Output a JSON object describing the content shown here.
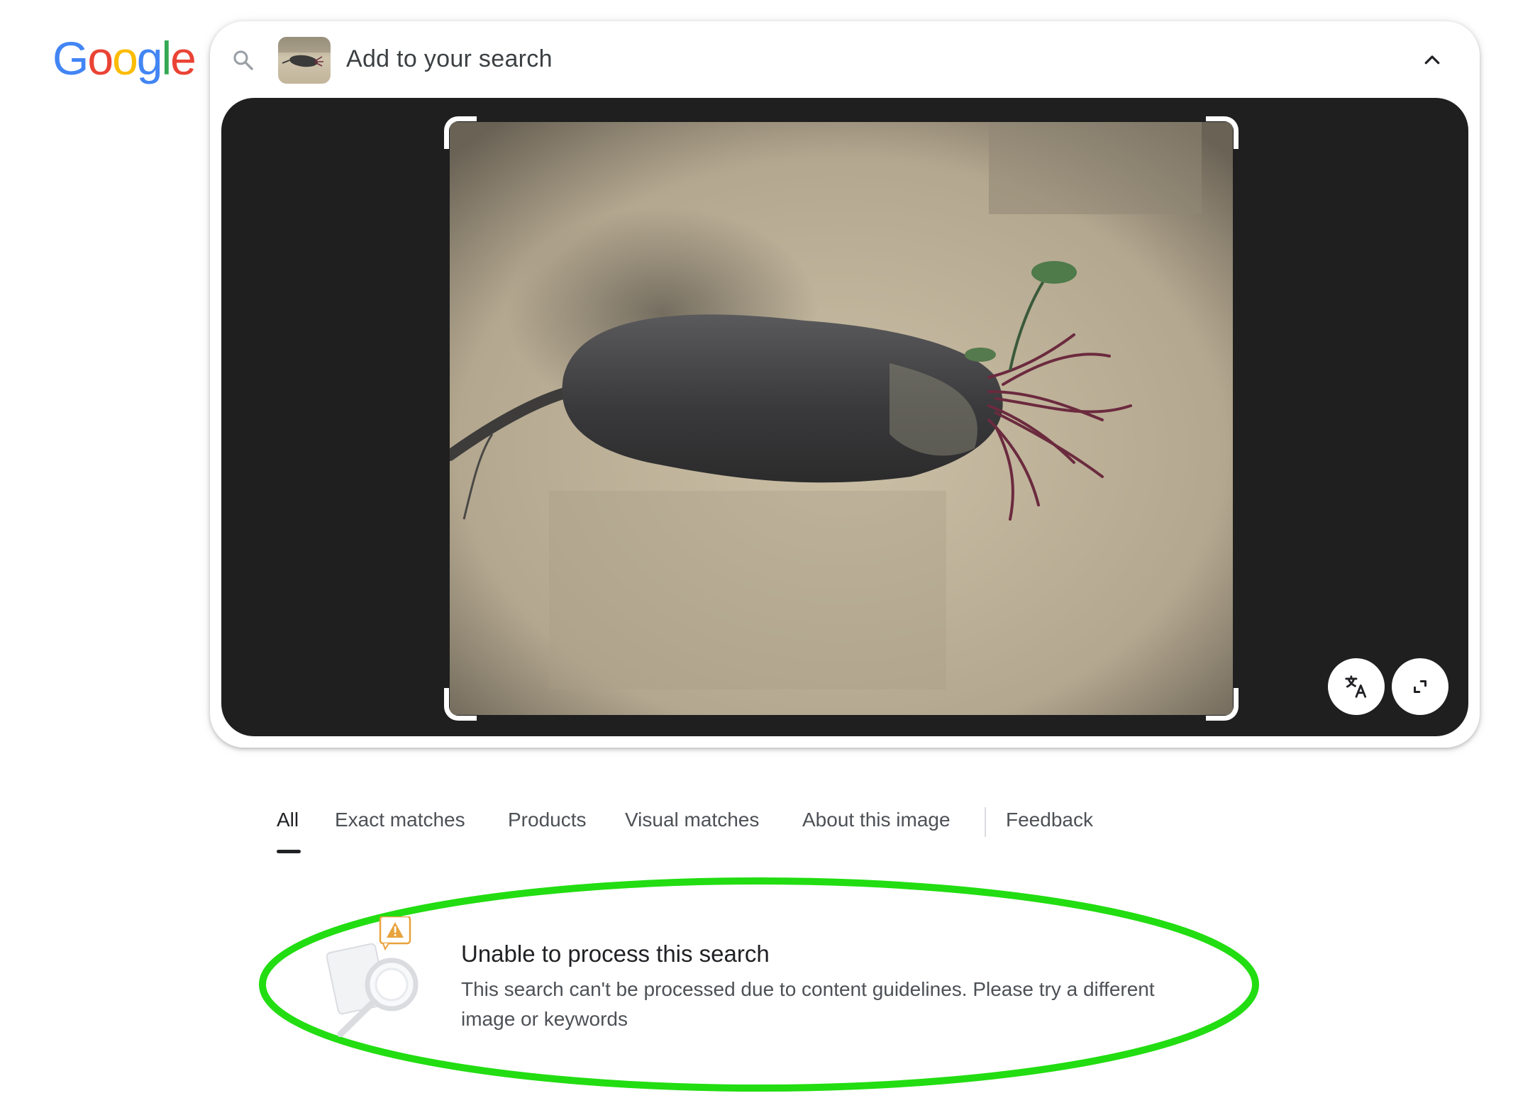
{
  "logo": {
    "text": "Google",
    "letters": [
      "G",
      "o",
      "o",
      "g",
      "l",
      "e"
    ],
    "colors": [
      "#4285F4",
      "#EA4335",
      "#FBBC05",
      "#4285F4",
      "#34A853",
      "#EA4335"
    ]
  },
  "search": {
    "placeholder": "Add to your search",
    "search_icon": "search-icon",
    "collapse_icon": "chevron-up-icon"
  },
  "viewer": {
    "translate_icon": "translate-icon",
    "expand_icon": "expand-icon",
    "background": "#1f1f1f"
  },
  "tabs": [
    {
      "label": "All",
      "active": true
    },
    {
      "label": "Exact matches",
      "active": false
    },
    {
      "label": "Products",
      "active": false
    },
    {
      "label": "Visual matches",
      "active": false
    },
    {
      "label": "About this image",
      "active": false
    },
    {
      "label": "Feedback",
      "active": false
    }
  ],
  "error": {
    "title": "Unable to process this search",
    "body": "This search can't be processed due to content guidelines. Please try a different image or keywords",
    "icon": "warning-magnifier-illustration",
    "highlight_color": "#22dd11"
  }
}
